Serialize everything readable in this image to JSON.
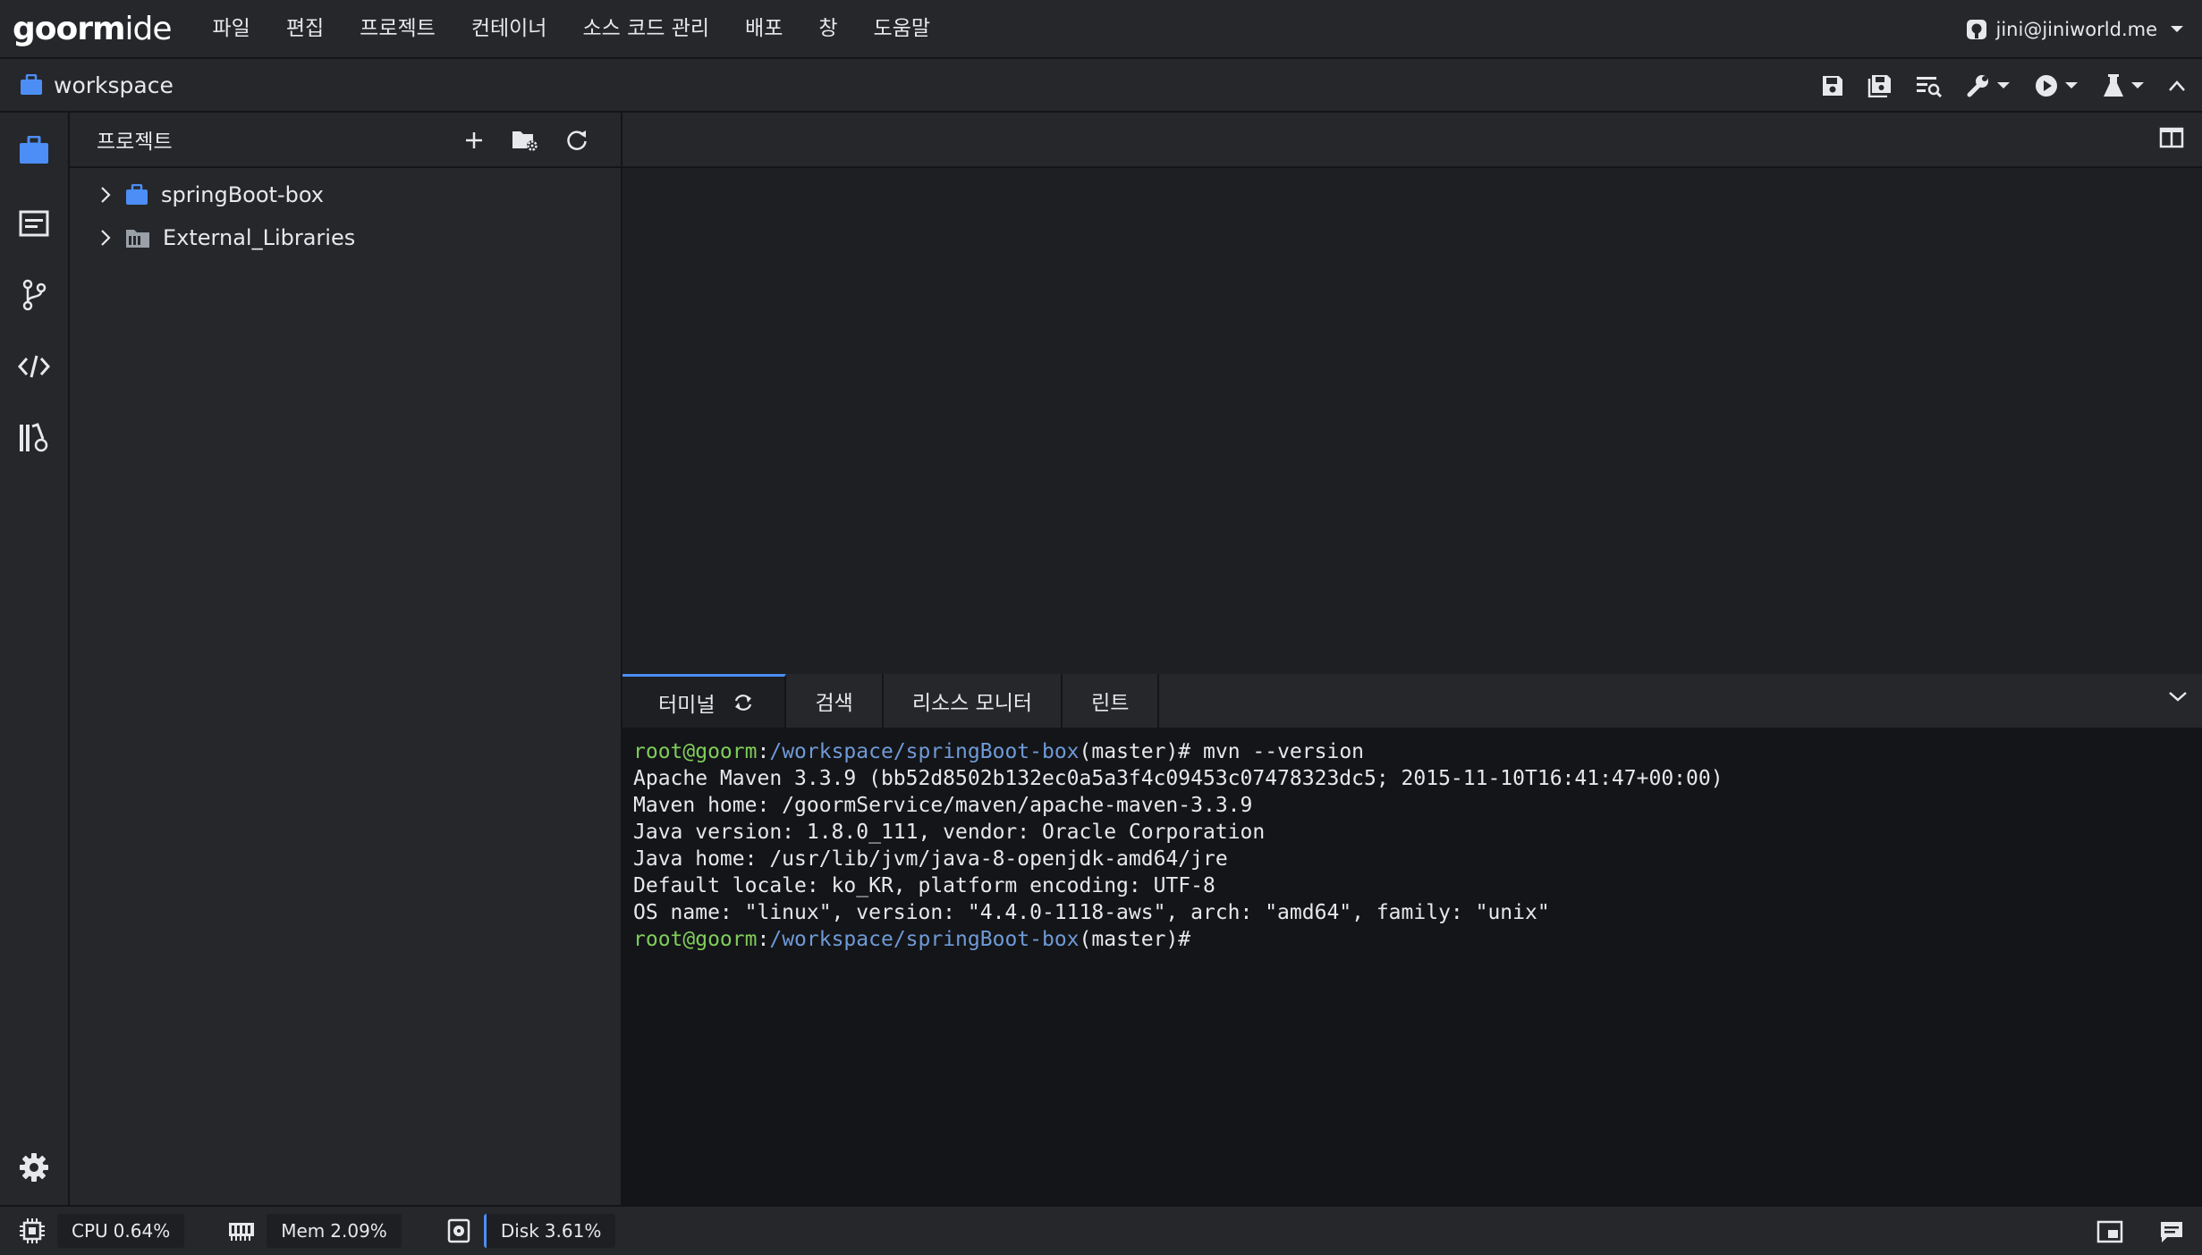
{
  "app": {
    "logo_bold": "goorm",
    "logo_light": "ide"
  },
  "menu": [
    "파일",
    "편집",
    "프로젝트",
    "컨테이너",
    "소스 코드 관리",
    "배포",
    "창",
    "도움말"
  ],
  "user": {
    "email": "jini@jiniworld.me"
  },
  "workspace": {
    "title": "workspace"
  },
  "project_panel": {
    "title": "프로젝트",
    "items": [
      {
        "label": "springBoot-box",
        "icon": "briefcase-icon"
      },
      {
        "label": "External_Libraries",
        "icon": "library-folder-icon"
      }
    ]
  },
  "bottom_panel": {
    "tabs": [
      "터미널",
      "검색",
      "리소스 모니터",
      "린트"
    ],
    "active_tab": "터미널",
    "terminal": {
      "prompt_user": "root@goorm",
      "prompt_sep": ":",
      "prompt_path": "/workspace/springBoot-box",
      "prompt_branch": "(master)#",
      "command": " mvn --version",
      "output": [
        "Apache Maven 3.3.9 (bb52d8502b132ec0a5a3f4c09453c07478323dc5; 2015-11-10T16:41:47+00:00)",
        "Maven home: /goormService/maven/apache-maven-3.3.9",
        "Java version: 1.8.0_111, vendor: Oracle Corporation",
        "Java home: /usr/lib/jvm/java-8-openjdk-amd64/jre",
        "Default locale: ko_KR, platform encoding: UTF-8",
        "OS name: \"linux\", version: \"4.4.0-1118-aws\", arch: \"amd64\", family: \"unix\""
      ]
    }
  },
  "status": {
    "cpu_label": "CPU",
    "cpu_value": "0.64%",
    "mem_label": "Mem",
    "mem_value": "2.09%",
    "disk_label": "Disk",
    "disk_value": "3.61%"
  },
  "colors": {
    "accent": "#4c8ef5",
    "prompt_user": "#7fce5a",
    "prompt_path": "#6f9ad8",
    "background": "#1d1f22"
  }
}
